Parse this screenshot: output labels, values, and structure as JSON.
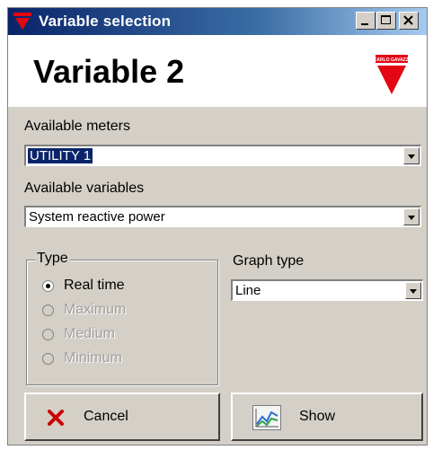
{
  "window": {
    "title": "Variable selection",
    "controls": [
      "minimize-button",
      "maximize-button",
      "close-button"
    ]
  },
  "header": {
    "title": "Variable 2",
    "logo_text": "CARLO GAVAZZI",
    "logo_color": "#e30613"
  },
  "meters": {
    "label": "Available meters",
    "selected": "UTILITY 1"
  },
  "variables": {
    "label": "Available variables",
    "selected": "System reactive power"
  },
  "type_group": {
    "title": "Type",
    "options": [
      {
        "label": "Real time",
        "checked": true,
        "enabled": true
      },
      {
        "label": "Maximum",
        "checked": false,
        "enabled": false
      },
      {
        "label": "Medium",
        "checked": false,
        "enabled": false
      },
      {
        "label": "Minimum",
        "checked": false,
        "enabled": false
      }
    ]
  },
  "graph_type": {
    "label": "Graph type",
    "selected": "Line"
  },
  "buttons": {
    "cancel": "Cancel",
    "show": "Show"
  },
  "colors": {
    "title_bar_start": "#0a246a",
    "title_bar_end": "#a6caf0",
    "face": "#d4d0c8",
    "selection": "#0a246a",
    "cancel_icon": "#cc0000"
  }
}
